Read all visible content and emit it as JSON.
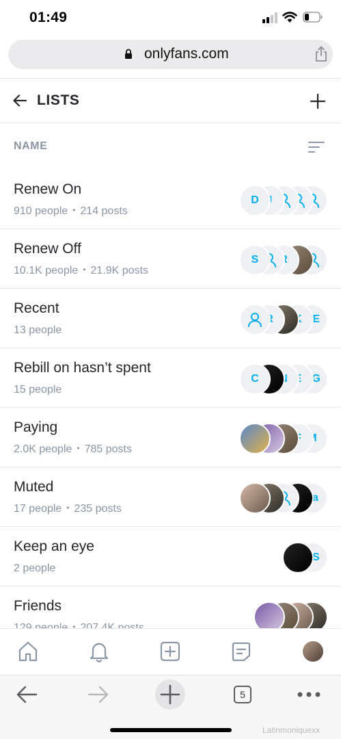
{
  "status": {
    "time": "01:49"
  },
  "browser": {
    "url": "onlyfans.com",
    "tab_count": "5"
  },
  "header": {
    "title": "LISTS"
  },
  "sort": {
    "label": "NAME"
  },
  "lists": [
    {
      "name": "Renew On",
      "people": "910 people",
      "posts": "214 posts",
      "avatars": [
        "D",
        "J",
        "user-icon",
        "user-icon",
        "user-icon"
      ]
    },
    {
      "name": "Renew Off",
      "people": "10.1K people",
      "posts": "21.9K posts",
      "avatars": [
        "S",
        "user-icon",
        "R",
        "photo",
        "user-icon"
      ]
    },
    {
      "name": "Recent",
      "people": "13 people",
      "posts": "",
      "avatars": [
        "user-icon",
        "R",
        "photo",
        "K",
        "RE"
      ]
    },
    {
      "name": "Rebill on hasn’t spent",
      "people": "15 people",
      "posts": "",
      "avatars": [
        "C",
        "photo",
        "N",
        "E",
        "CG"
      ]
    },
    {
      "name": "Paying",
      "people": "2.0K people",
      "posts": "785 posts",
      "avatars": [
        "photo",
        "photo",
        "photo",
        "F",
        "M"
      ]
    },
    {
      "name": "Muted",
      "people": "17 people",
      "posts": "235 posts",
      "avatars": [
        "photo",
        "photo",
        "user-icon",
        "photo",
        "Ja"
      ]
    },
    {
      "name": "Keep an eye",
      "people": "2 people",
      "posts": "",
      "avatars": [
        "photo",
        "SS"
      ]
    },
    {
      "name": "Friends",
      "people": "129 people",
      "posts": "207.4K posts",
      "avatars": [
        "photo",
        "photo",
        "photo",
        "photo"
      ]
    }
  ],
  "watermark": "Latinmoniquexx",
  "colors": {
    "accent": "#00aff0",
    "muted_text": "#8a96a3",
    "divider": "#e7e7ea"
  }
}
